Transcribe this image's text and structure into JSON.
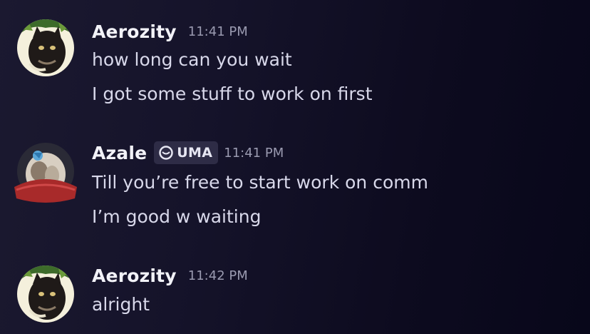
{
  "messages": [
    {
      "author": "Aerozity",
      "time": "11:41 PM",
      "avatar_icon": "cat-avatar-icon",
      "lines": [
        "how long can you wait",
        "I got some stuff to work on first"
      ]
    },
    {
      "author": "Azale",
      "time": "11:41 PM",
      "avatar_icon": "cat-avatar-icon",
      "tag": {
        "label": "UMA",
        "icon": "guild-tag-icon"
      },
      "lines": [
        "Till you’re free to start work on comm",
        "I’m good w waiting"
      ]
    },
    {
      "author": "Aerozity",
      "time": "11:42 PM",
      "avatar_icon": "cat-avatar-icon",
      "lines": [
        "alright"
      ]
    }
  ],
  "colors": {
    "background": "#15132a",
    "username": "#f2f2f8",
    "timestamp": "#9a9ab0",
    "message_text": "#d8d8ea",
    "tag_background": "#2e2c46"
  }
}
